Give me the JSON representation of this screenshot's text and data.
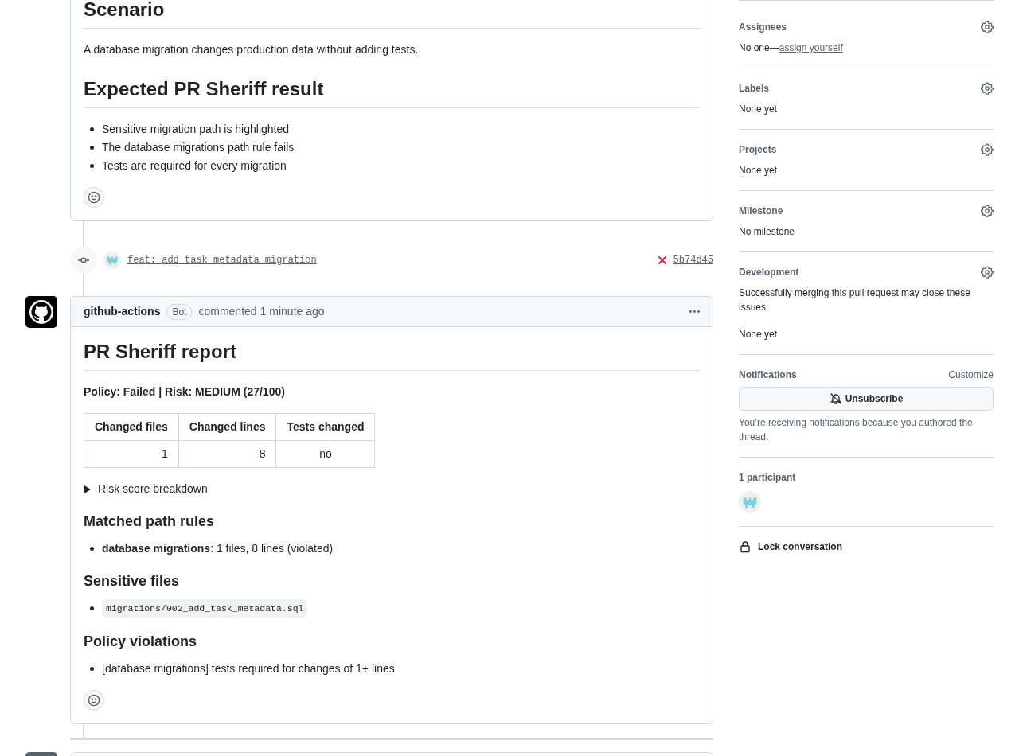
{
  "description": {
    "heading": "Scenario",
    "text": "A database migration changes production data without adding tests.",
    "result_heading": "Expected PR Sheriff result",
    "items": [
      "Sensitive migration path is highlighted",
      "The database migrations path rule fails",
      "Tests are required for every migration"
    ]
  },
  "commit": {
    "message": "feat: add task metadata migration",
    "checks_failed": true,
    "sha": "5b74d45"
  },
  "comment": {
    "author": "github-actions",
    "badge": "Bot",
    "action": "commented",
    "time": "1 minute ago",
    "title": "PR Sheriff report",
    "summary": "Policy: Failed | Risk: MEDIUM (27/100)",
    "table": {
      "columns": [
        "Changed files",
        "Changed lines",
        "Tests changed"
      ],
      "rows": [
        [
          "1",
          "8",
          "no"
        ]
      ]
    },
    "details": {
      "summary": "Risk score breakdown",
      "expanded": false
    },
    "sections": [
      {
        "heading": "Matched path rules",
        "items": [
          {
            "kind": "text",
            "text": "**database migrations**: 1 files, 8 lines (violated)"
          }
        ]
      },
      {
        "heading": "Sensitive files",
        "items": [
          {
            "kind": "code",
            "text": "migrations/002_add_task_metadata.sql"
          }
        ]
      },
      {
        "heading": "Policy violations",
        "items": [
          {
            "kind": "text",
            "text": "[database migrations] tests required for changes of 1+ lines"
          }
        ]
      }
    ]
  },
  "sidebar": [
    {
      "kind": "field",
      "title": "Assignees",
      "value": "No one—",
      "link": "assign yourself"
    },
    {
      "kind": "field",
      "title": "Labels",
      "value": "None yet"
    },
    {
      "kind": "field",
      "title": "Projects",
      "value": "None yet"
    },
    {
      "kind": "field",
      "title": "Milestone",
      "value": "No milestone"
    },
    {
      "kind": "field",
      "title": "Development",
      "description": "Successfully merging this pull request may close these issues.",
      "value": "None yet"
    },
    {
      "kind": "notifications",
      "title": "Notifications",
      "link": "Customize",
      "button": "Unsubscribe",
      "note": "You’re receiving notifications because you authored the thread."
    },
    {
      "kind": "participants",
      "title": "1 participant"
    },
    {
      "kind": "lock",
      "title": "Lock conversation"
    }
  ]
}
